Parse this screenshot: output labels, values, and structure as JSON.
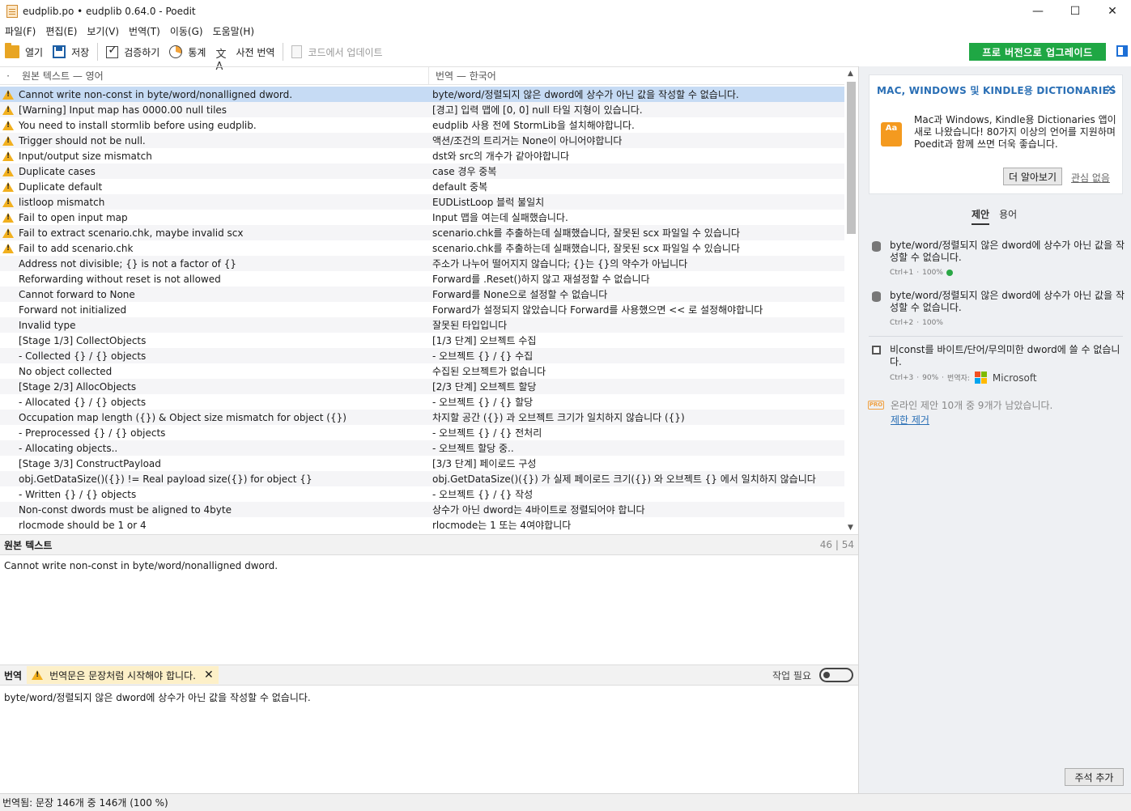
{
  "window": {
    "title": "eudplib.po • eudplib 0.64.0 - Poedit",
    "minimize": "—",
    "maximize": "☐",
    "close": "✕"
  },
  "menu": [
    "파일(F)",
    "편집(E)",
    "보기(V)",
    "번역(T)",
    "이동(G)",
    "도움말(H)"
  ],
  "toolbar": {
    "open": "열기",
    "save": "저장",
    "validate": "검증하기",
    "statistics": "통계",
    "pretranslate": "사전 번역",
    "update_from_code": "코드에서 업데이트",
    "upgrade": "프로 버전으로 업그레이드"
  },
  "list": {
    "header_dot": "·",
    "header_source": "원본 텍스트 — 영어",
    "header_translation": "번역 — 한국어",
    "rows": [
      {
        "src": "Cannot write non-const in byte/word/nonalligned dword.",
        "trans": "byte/word/정렬되지 않은 dword에 상수가 아닌 값을 작성할 수 없습니다.",
        "warn": true,
        "selected": true
      },
      {
        "src": "[Warning] Input map has 0000.00 null tiles",
        "trans": "[경고] 입력 맵에 [0, 0] null 타일 지형이 있습니다.",
        "warn": true
      },
      {
        "src": "You need to install stormlib before using eudplib.",
        "trans": "eudplib 사용 전에 StormLib을 설치해야합니다.",
        "warn": true
      },
      {
        "src": "Trigger should not be null.",
        "trans": "액션/조건의 트리거는 None이 아니어야합니다",
        "warn": true
      },
      {
        "src": "Input/output size mismatch",
        "trans": "dst와 src의 개수가 같아야합니다",
        "warn": true
      },
      {
        "src": "Duplicate cases",
        "trans": "case 경우 중복",
        "warn": true
      },
      {
        "src": "Duplicate default",
        "trans": "default 중복",
        "warn": true
      },
      {
        "src": "listloop mismatch",
        "trans": "EUDListLoop 블럭 불일치",
        "warn": true
      },
      {
        "src": "Fail to open input map",
        "trans": "Input 맵을 여는데 실패했습니다.",
        "warn": true
      },
      {
        "src": "Fail to extract scenario.chk, maybe invalid scx",
        "trans": "scenario.chk를 추출하는데 실패했습니다, 잘못된 scx 파일일 수 있습니다",
        "warn": true
      },
      {
        "src": "Fail to add scenario.chk",
        "trans": "scenario.chk를 추출하는데 실패했습니다, 잘못된 scx 파일일 수 있습니다",
        "warn": true
      },
      {
        "src": "Address not divisible; {} is not a factor of {}",
        "trans": "주소가 나누어 떨어지지 않습니다; {}는 {}의 약수가 아닙니다",
        "warn": false
      },
      {
        "src": "Reforwarding without reset is not allowed",
        "trans": "Forward를 .Reset()하지 않고 재설정할 수 없습니다",
        "warn": false
      },
      {
        "src": "Cannot forward to None",
        "trans": "Forward를 None으로 설정할 수 없습니다",
        "warn": false
      },
      {
        "src": "Forward not initialized",
        "trans": "Forward가 설정되지 않았습니다 Forward를 사용했으면 << 로 설정해야합니다",
        "warn": false
      },
      {
        "src": "Invalid type",
        "trans": "잘못된 타입입니다",
        "warn": false
      },
      {
        "src": "[Stage 1/3] CollectObjects",
        "trans": "[1/3 단계] 오브젝트 수집",
        "warn": false
      },
      {
        "src": "- Collected {} / {} objects",
        "trans": "- 오브젝트 {} / {} 수집",
        "warn": false
      },
      {
        "src": "No object collected",
        "trans": "수집된 오브젝트가 없습니다",
        "warn": false
      },
      {
        "src": "[Stage 2/3] AllocObjects",
        "trans": "[2/3 단계] 오브젝트 할당",
        "warn": false
      },
      {
        "src": "- Allocated {} / {} objects",
        "trans": "- 오브젝트 {} / {} 할당",
        "warn": false
      },
      {
        "src": "Occupation map length ({}) & Object size mismatch for object ({})",
        "trans": "차지할 공간 ({}) 과 오브젝트 크기가 일치하지 않습니다 ({})",
        "warn": false
      },
      {
        "src": "- Preprocessed {} / {} objects",
        "trans": "- 오브젝트 {} / {} 전처리",
        "warn": false
      },
      {
        "src": "- Allocating objects..",
        "trans": "- 오브젝트 할당 중..",
        "warn": false
      },
      {
        "src": "[Stage 3/3] ConstructPayload",
        "trans": "[3/3 단계] 페이로드 구성",
        "warn": false
      },
      {
        "src": "obj.GetDataSize()({}) != Real payload size({}) for object {}",
        "trans": "obj.GetDataSize()({}) 가 실제 페이로드 크기({}) 와 오브젝트 {} 에서 일치하지 않습니다",
        "warn": false
      },
      {
        "src": "- Written {} / {} objects",
        "trans": "- 오브젝트 {} / {} 작성",
        "warn": false
      },
      {
        "src": "Non-const dwords must be aligned to 4byte",
        "trans": "상수가 아닌 dword는 4바이트로 정렬되어야 합니다",
        "warn": false
      },
      {
        "src": "rlocmode should be 1 or 4",
        "trans": "rlocmode는 1 또는 4여야합니다",
        "warn": false
      }
    ]
  },
  "source_pane": {
    "label": "원본 텍스트",
    "counter": "46 | 54",
    "text": "Cannot write non-const in byte/word/nonalligned dword."
  },
  "translation_pane": {
    "label": "번역",
    "warning": "번역문은 문장처럼 시작해야 합니다.",
    "warning_close": "✕",
    "needs_work": "작업 필요",
    "needs_work_on": false,
    "text": "byte/word/정렬되지 않은 dword에 상수가 아닌 값을 작성할 수 없습니다."
  },
  "sidebar": {
    "promo": {
      "title": "MAC, WINDOWS 및 KINDLE용 DICTIONARIES",
      "close": "✕",
      "icon_text": "Aa",
      "body": "Mac과 Windows, Kindle용 Dictionaries 앱이 새로 나왔습니다! 80가지 이상의 언어를 지원하며 Poedit과 함께 쓰면 더욱 좋습니다.",
      "learn_more": "더 알아보기",
      "not_interested": "관심 없음"
    },
    "tabs": [
      "제안",
      "용어"
    ],
    "active_tab": "제안",
    "suggestions": [
      {
        "text": "byte/word/정렬되지 않은 dword에 상수가 아닌 값을 작성할 수 없습니다.",
        "shortcut": "Ctrl+1",
        "score": "100%",
        "icon": "database-icon",
        "verified": true
      },
      {
        "text": "byte/word/정렬되지 않은 dword에 상수가 아닌 값을 작성할 수 없습니다.",
        "shortcut": "Ctrl+2",
        "score": "100%",
        "icon": "database-icon",
        "verified": false
      },
      {
        "text": "비const를 바이트/단어/무의미한 dword에 쓸 수 없습니다.",
        "shortcut": "Ctrl+3",
        "score": "90%",
        "translator_label": "번역자:",
        "translator": "Microsoft",
        "icon": "machine-translation-icon"
      }
    ],
    "pro_badge": "PRO",
    "remaining": "온라인 제안 10개 중 9개가 남았습니다.",
    "remove_limit": "제한 제거",
    "add_comment": "주석 추가"
  },
  "status": {
    "text": "번역됨: 문장 146개 중 146개 (100 %)"
  },
  "colors": {
    "selected_row": "#c6dbf4",
    "warning": "#f2b01e",
    "upgrade_button": "#1fa744",
    "link": "#2a6fb5"
  }
}
